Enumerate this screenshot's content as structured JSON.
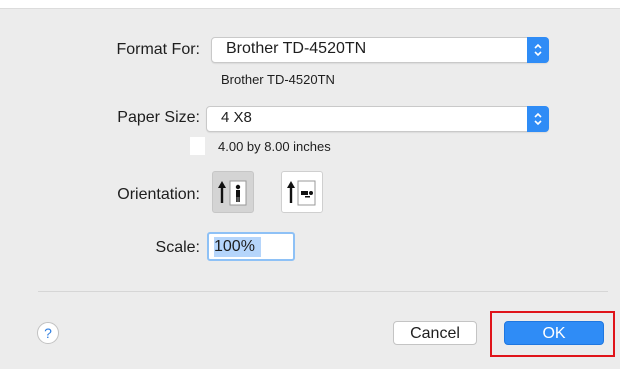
{
  "format_for": {
    "label": "Format For:",
    "value": "Brother TD-4520TN",
    "subtitle": "Brother TD-4520TN"
  },
  "paper_size": {
    "label": "Paper Size:",
    "value": "4 X8",
    "subtitle": "4.00 by 8.00 inches"
  },
  "orientation": {
    "label": "Orientation:",
    "options": [
      "portrait",
      "landscape"
    ],
    "selected": "portrait"
  },
  "scale": {
    "label": "Scale:",
    "value": "100%"
  },
  "buttons": {
    "help": "?",
    "cancel": "Cancel",
    "ok": "OK"
  },
  "colors": {
    "accent": "#2f8cf6",
    "highlight_border": "#e0141a"
  }
}
